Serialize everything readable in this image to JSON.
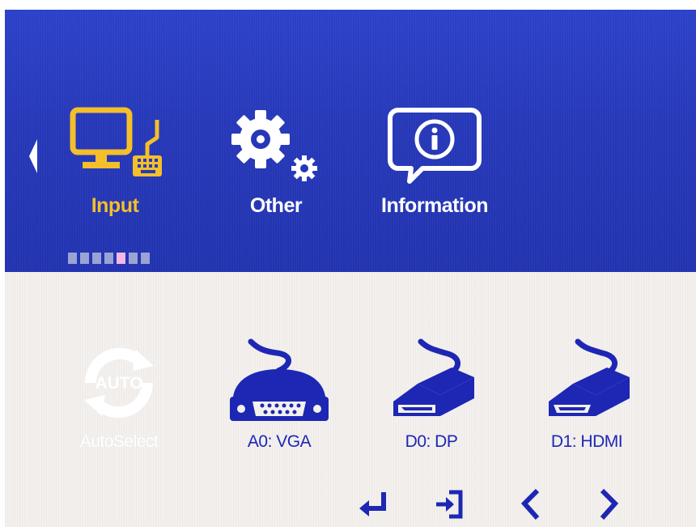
{
  "menu": {
    "tabs": [
      {
        "id": "input",
        "label": "Input",
        "icon": "monitor-keyboard-icon",
        "selected": true
      },
      {
        "id": "other",
        "label": "Other",
        "icon": "gear-icon",
        "selected": false
      },
      {
        "id": "information",
        "label": "Information",
        "icon": "info-bubble-icon",
        "selected": false
      }
    ],
    "scroll_icon": "triangle-left-icon",
    "page_indicator": {
      "count": 7,
      "current": 5
    }
  },
  "sources": [
    {
      "id": "auto",
      "label": "AutoSelect",
      "badge": "AUTO",
      "icon": "auto-cycle-icon",
      "enabled": false
    },
    {
      "id": "vga",
      "label": "A0: VGA",
      "icon": "vga-connector-icon",
      "enabled": true
    },
    {
      "id": "dp",
      "label": "D0: DP",
      "icon": "displayport-connector-icon",
      "enabled": true
    },
    {
      "id": "hdmi",
      "label": "D1: HDMI",
      "icon": "hdmi-connector-icon",
      "enabled": true
    }
  ],
  "nav_keys": [
    {
      "id": "enter",
      "icon": "enter-arrow-icon"
    },
    {
      "id": "exit",
      "icon": "exit-door-icon"
    },
    {
      "id": "left",
      "icon": "chevron-left-icon"
    },
    {
      "id": "right",
      "icon": "chevron-right-icon"
    }
  ],
  "colors": {
    "menu_blue": "#2638b8",
    "selected_yellow": "#f3bf2a",
    "source_blue": "#1d27b4",
    "panel_bg": "#f3f0ee",
    "page_dot": "#9aa3d3",
    "page_dot_current": "#f3b8e6"
  }
}
